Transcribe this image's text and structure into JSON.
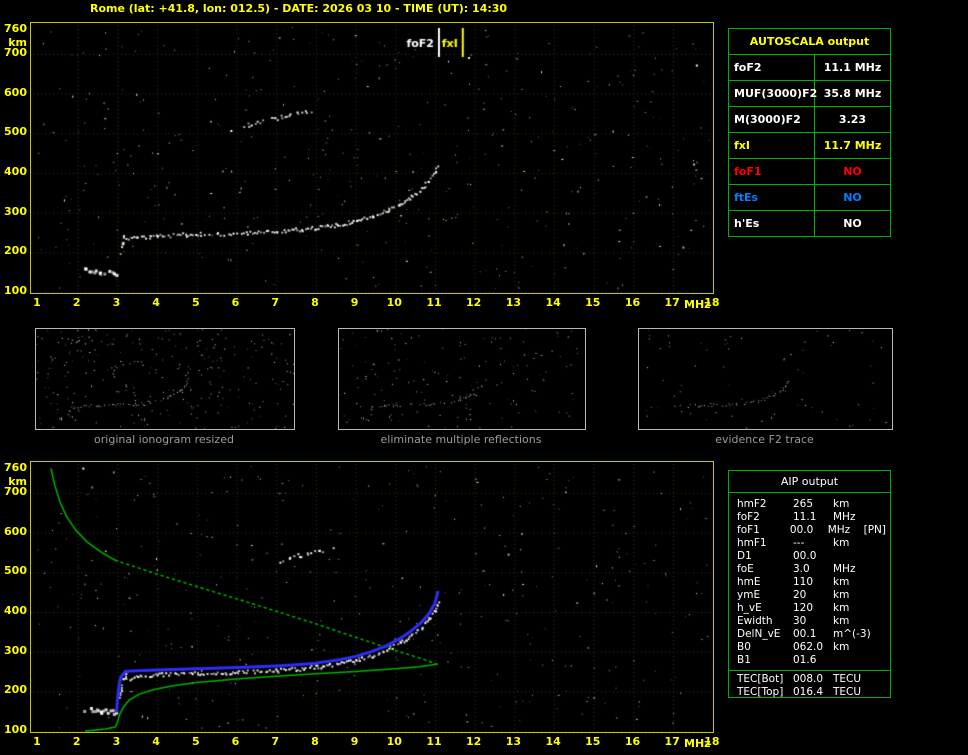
{
  "header": {
    "title": "Rome (lat: +41.8, lon: 012.5) - DATE: 2026 03 10 - TIME (UT): 14:30"
  },
  "colors": {
    "accent_yellow": "#ffff00",
    "table_border_green": "#00b000",
    "plot_border_yellow": "#c8c800",
    "trace_white": "#ffffff",
    "restored_trace_blue": "#2d2dff",
    "profile_green": "#00b400",
    "caption_gray": "#9a9a9a"
  },
  "autoscala_table": {
    "title": "AUTOSCALA output",
    "rows": [
      {
        "label": "foF2",
        "value": "11.1 MHz",
        "color": "#ffffff"
      },
      {
        "label": "MUF(3000)F2",
        "value": "35.8 MHz",
        "color": "#ffffff"
      },
      {
        "label": "M(3000)F2",
        "value": "3.23",
        "color": "#ffffff"
      },
      {
        "label": "fxI",
        "value": "11.7 MHz",
        "color": "#ffff00"
      },
      {
        "label": "foF1",
        "value": "NO",
        "color": "#ff0000"
      },
      {
        "label": "ftEs",
        "value": "NO",
        "color": "#0080ff"
      },
      {
        "label": "h'Es",
        "value": "NO",
        "color": "#ffffff"
      }
    ]
  },
  "aip_table": {
    "title": "AIP output",
    "rows": [
      {
        "label": "hmF2",
        "value": "265",
        "unit": "km",
        "extra": ""
      },
      {
        "label": "foF2",
        "value": "11.1",
        "unit": "MHz",
        "extra": ""
      },
      {
        "label": "foF1",
        "value": "00.0",
        "unit": "MHz",
        "extra": "[PN]"
      },
      {
        "label": "hmF1",
        "value": "---",
        "unit": "km",
        "extra": ""
      },
      {
        "label": "D1",
        "value": "00.0",
        "unit": "",
        "extra": ""
      },
      {
        "label": "foE",
        "value": "3.0",
        "unit": "MHz",
        "extra": ""
      },
      {
        "label": "hmE",
        "value": "110",
        "unit": "km",
        "extra": ""
      },
      {
        "label": "ymE",
        "value": "20",
        "unit": "km",
        "extra": ""
      },
      {
        "label": "h_vE",
        "value": "120",
        "unit": "km",
        "extra": ""
      },
      {
        "label": "Ewidth",
        "value": "30",
        "unit": "km",
        "extra": ""
      },
      {
        "label": "DelN_vE",
        "value": "00.1",
        "unit": "m^(-3)",
        "extra": ""
      },
      {
        "label": "B0",
        "value": "062.0",
        "unit": "km",
        "extra": ""
      },
      {
        "label": "B1",
        "value": "01.6",
        "unit": "",
        "extra": ""
      },
      {
        "label": "TEC[Bot]",
        "value": "008.0",
        "unit": "TECU",
        "extra": ""
      },
      {
        "label": "TEC[Top]",
        "value": "016.4",
        "unit": "TECU",
        "extra": ""
      }
    ]
  },
  "axes": {
    "x_unit": "MHz",
    "y_unit": "km"
  },
  "thumbnails": [
    {
      "caption": "original ionogram resized",
      "traces": [
        "Es-trace",
        "fmin-cusp",
        "F2-trace",
        "second-hop"
      ],
      "noise": 280,
      "seed": 11
    },
    {
      "caption": "eliminate multiple reflections",
      "traces": [
        "Es-trace",
        "fmin-cusp",
        "F2-trace"
      ],
      "noise": 150,
      "seed": 12
    },
    {
      "caption": "evidence F2 trace",
      "traces": [
        "F2-trace"
      ],
      "noise": 70,
      "seed": 13
    }
  ],
  "chart_data": [
    {
      "id": "plot-top",
      "name": "scaled ionogram with autoscala frequency markers",
      "type": "scatter",
      "xlabel": "MHz",
      "ylabel": "km",
      "xlim": [
        1,
        18
      ],
      "ylim": [
        100,
        760
      ],
      "x_ticks": [
        1,
        2,
        3,
        4,
        5,
        6,
        7,
        8,
        9,
        10,
        11,
        12,
        13,
        14,
        15,
        16,
        17,
        18
      ],
      "y_ticks": [
        760,
        700,
        600,
        500,
        400,
        300,
        200,
        100
      ],
      "grid": "dotted",
      "markers": [
        {
          "label": "foF2",
          "x_mhz": 11.1,
          "color": "#ffffff"
        },
        {
          "label": "fxI",
          "x_mhz": 11.7,
          "color": "#ffff00"
        }
      ],
      "noise": {
        "count": 430,
        "seed": 7
      },
      "traces": [
        {
          "name": "Es-trace",
          "color": "#ffffff",
          "dot": 3,
          "gap": 0.15,
          "points": [
            [
              2.15,
              158
            ],
            [
              2.55,
              153
            ],
            [
              2.95,
              150
            ]
          ]
        },
        {
          "name": "fmin-cusp",
          "color": "#ffffff",
          "dot": 2,
          "gap": 0.2,
          "points": [
            [
              3.05,
              190
            ],
            [
              3.1,
              220
            ],
            [
              3.18,
              245
            ]
          ]
        },
        {
          "name": "F2-trace",
          "color": "#ffffff",
          "dot": 2,
          "gap": 0.12,
          "points": [
            [
              3.2,
              232
            ],
            [
              3.5,
              240
            ],
            [
              4,
              243
            ],
            [
              5,
              247
            ],
            [
              6,
              250
            ],
            [
              6.5,
              252
            ],
            [
              7,
              254
            ],
            [
              7.5,
              258
            ],
            [
              8,
              263
            ],
            [
              8.5,
              270
            ],
            [
              9,
              280
            ],
            [
              9.4,
              292
            ],
            [
              9.8,
              308
            ],
            [
              10.1,
              323
            ],
            [
              10.4,
              342
            ],
            [
              10.65,
              362
            ],
            [
              10.85,
              385
            ],
            [
              11.0,
              408
            ],
            [
              11.08,
              425
            ]
          ]
        },
        {
          "name": "second-hop",
          "color": "#ffffff",
          "dot": 2,
          "gap": 0.45,
          "points": [
            [
              5.8,
              505
            ],
            [
              6.3,
              522
            ],
            [
              6.8,
              536
            ],
            [
              7.3,
              547
            ],
            [
              7.9,
              556
            ]
          ]
        }
      ]
    },
    {
      "id": "plot-bottom",
      "name": "ionogram with restored trace and electron density profile",
      "type": "scatter",
      "xlabel": "MHz",
      "ylabel": "km",
      "xlim": [
        1,
        18
      ],
      "ylim": [
        100,
        760
      ],
      "x_ticks": [
        1,
        2,
        3,
        4,
        5,
        6,
        7,
        8,
        9,
        10,
        11,
        12,
        13,
        14,
        15,
        16,
        17,
        18
      ],
      "y_ticks": [
        760,
        700,
        600,
        500,
        400,
        300,
        200,
        100
      ],
      "grid": "dotted",
      "noise": {
        "count": 380,
        "seed": 9
      },
      "traces": [
        {
          "name": "Es-trace",
          "color": "#ffffff",
          "dot": 3,
          "gap": 0.15,
          "points": [
            [
              2.15,
              158
            ],
            [
              2.55,
              153
            ],
            [
              2.95,
              150
            ]
          ]
        },
        {
          "name": "fmin-cusp",
          "color": "#ffffff",
          "dot": 2,
          "gap": 0.2,
          "points": [
            [
              3.05,
              190
            ],
            [
              3.1,
              220
            ],
            [
              3.18,
              245
            ]
          ]
        },
        {
          "name": "F2-trace",
          "color": "#ffffff",
          "dot": 2,
          "gap": 0.12,
          "points": [
            [
              3.2,
              232
            ],
            [
              3.5,
              240
            ],
            [
              4,
              243
            ],
            [
              5,
              247
            ],
            [
              6,
              250
            ],
            [
              6.5,
              252
            ],
            [
              7,
              254
            ],
            [
              7.5,
              258
            ],
            [
              8,
              263
            ],
            [
              8.5,
              270
            ],
            [
              9,
              280
            ],
            [
              9.4,
              292
            ],
            [
              9.8,
              308
            ],
            [
              10.1,
              323
            ],
            [
              10.4,
              342
            ],
            [
              10.65,
              362
            ],
            [
              10.85,
              385
            ],
            [
              11.0,
              408
            ],
            [
              11.08,
              425
            ]
          ]
        },
        {
          "name": "second-hop",
          "color": "#ffffff",
          "dot": 2,
          "gap": 0.55,
          "points": [
            [
              7.1,
              528
            ],
            [
              7.6,
              545
            ],
            [
              8.1,
              556
            ],
            [
              8.4,
              562
            ]
          ]
        }
      ],
      "blue_trace": {
        "name": "restored-F2-trace",
        "color": "#2d2dff",
        "width": 3,
        "points": [
          [
            2.98,
            150
          ],
          [
            3.02,
            200
          ],
          [
            3.08,
            235
          ],
          [
            3.2,
            250
          ],
          [
            3.5,
            252
          ],
          [
            4,
            254
          ],
          [
            5,
            257
          ],
          [
            6,
            260
          ],
          [
            6.5,
            262
          ],
          [
            7,
            264
          ],
          [
            7.5,
            267
          ],
          [
            8,
            271
          ],
          [
            8.5,
            278
          ],
          [
            9,
            288
          ],
          [
            9.4,
            300
          ],
          [
            9.8,
            316
          ],
          [
            10.1,
            332
          ],
          [
            10.4,
            352
          ],
          [
            10.65,
            373
          ],
          [
            10.85,
            396
          ],
          [
            11.0,
            422
          ],
          [
            11.07,
            450
          ]
        ]
      },
      "profile": {
        "name": "electron-density-profile",
        "color": "#00b400",
        "topside_solid": [
          [
            1.33,
            760
          ],
          [
            1.42,
            720
          ],
          [
            1.55,
            678
          ],
          [
            1.72,
            640
          ],
          [
            1.95,
            606
          ],
          [
            2.25,
            575
          ],
          [
            2.6,
            550
          ],
          [
            2.95,
            530
          ]
        ],
        "topside_dotted": [
          [
            2.95,
            530
          ],
          [
            4.0,
            495
          ],
          [
            5.0,
            464
          ],
          [
            6.0,
            433
          ],
          [
            7.0,
            402
          ],
          [
            8.0,
            370
          ],
          [
            9.0,
            336
          ],
          [
            10.0,
            303
          ],
          [
            10.7,
            281
          ],
          [
            11.05,
            268
          ]
        ],
        "bottomside_solid": [
          [
            11.05,
            268
          ],
          [
            10.6,
            262
          ],
          [
            10.0,
            257
          ],
          [
            9.0,
            250
          ],
          [
            8.0,
            244
          ],
          [
            7.0,
            238
          ],
          [
            6.0,
            231
          ],
          [
            5.0,
            222
          ],
          [
            4.4,
            214
          ],
          [
            3.9,
            204
          ],
          [
            3.55,
            193
          ],
          [
            3.3,
            178
          ],
          [
            3.15,
            160
          ],
          [
            3.05,
            140
          ],
          [
            3.0,
            122
          ],
          [
            2.95,
            110
          ],
          [
            2.7,
            105
          ],
          [
            2.4,
            102
          ],
          [
            2.2,
            100
          ]
        ]
      }
    }
  ]
}
